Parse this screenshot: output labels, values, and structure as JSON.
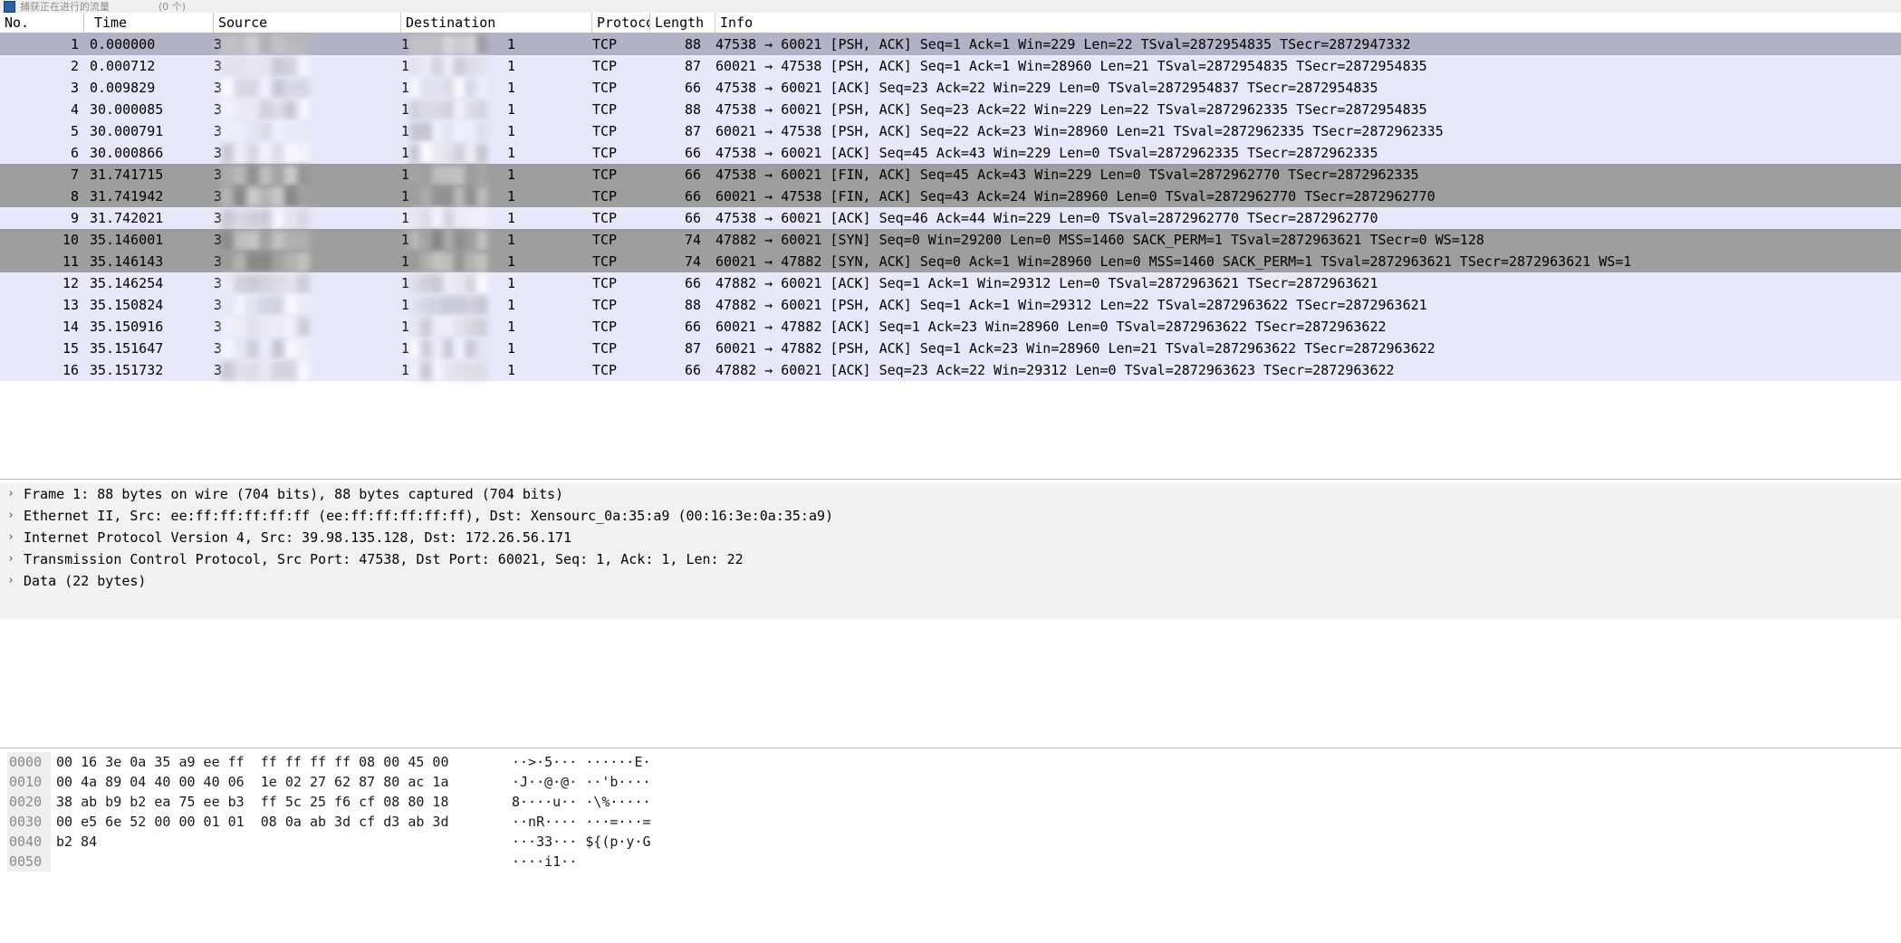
{
  "window": {
    "title_text": "捕获正在进行的流量",
    "title_suffix": "(0 个)"
  },
  "packet_list": {
    "columns": [
      {
        "key": "no",
        "label": "No."
      },
      {
        "key": "time",
        "label": "Time"
      },
      {
        "key": "src",
        "label": "Source"
      },
      {
        "key": "dst",
        "label": "Destination"
      },
      {
        "key": "prot",
        "label": "Protocol"
      },
      {
        "key": "len",
        "label": "Length"
      },
      {
        "key": "info",
        "label": "Info"
      }
    ],
    "redacted_src_prefix": "3",
    "redacted_src_suffix": "",
    "redacted_dst_prefix": "1",
    "redacted_dst_suffix": "1",
    "rows": [
      {
        "no": "1",
        "time": "0.000000",
        "prot": "TCP",
        "len": "88",
        "info": "47538 → 60021 [PSH, ACK] Seq=1 Ack=1 Win=229 Len=22 TSval=2872954835 TSecr=2872947332",
        "state": "selected"
      },
      {
        "no": "2",
        "time": "0.000712",
        "prot": "TCP",
        "len": "87",
        "info": "60021 → 47538 [PSH, ACK] Seq=1 Ack=1 Win=28960 Len=21 TSval=2872954835 TSecr=2872954835",
        "state": "normal"
      },
      {
        "no": "3",
        "time": "0.009829",
        "prot": "TCP",
        "len": "66",
        "info": "47538 → 60021 [ACK] Seq=23 Ack=22 Win=229 Len=0 TSval=2872954837 TSecr=2872954835",
        "state": "normal"
      },
      {
        "no": "4",
        "time": "30.000085",
        "prot": "TCP",
        "len": "88",
        "info": "47538 → 60021 [PSH, ACK] Seq=23 Ack=22 Win=229 Len=22 TSval=2872962335 TSecr=2872954835",
        "state": "normal"
      },
      {
        "no": "5",
        "time": "30.000791",
        "prot": "TCP",
        "len": "87",
        "info": "60021 → 47538 [PSH, ACK] Seq=22 Ack=23 Win=28960 Len=21 TSval=2872962335 TSecr=2872962335",
        "state": "normal"
      },
      {
        "no": "6",
        "time": "30.000866",
        "prot": "TCP",
        "len": "66",
        "info": "47538 → 60021 [ACK] Seq=45 Ack=43 Win=229 Len=0 TSval=2872962335 TSecr=2872962335",
        "state": "normal"
      },
      {
        "no": "7",
        "time": "31.741715",
        "prot": "TCP",
        "len": "66",
        "info": "47538 → 60021 [FIN, ACK] Seq=45 Ack=43 Win=229 Len=0 TSval=2872962770 TSecr=2872962335",
        "state": "marked"
      },
      {
        "no": "8",
        "time": "31.741942",
        "prot": "TCP",
        "len": "66",
        "info": "60021 → 47538 [FIN, ACK] Seq=43 Ack=24 Win=28960 Len=0 TSval=2872962770 TSecr=2872962770",
        "state": "marked"
      },
      {
        "no": "9",
        "time": "31.742021",
        "prot": "TCP",
        "len": "66",
        "info": "47538 → 60021 [ACK] Seq=46 Ack=44 Win=229 Len=0 TSval=2872962770 TSecr=2872962770",
        "state": "normal"
      },
      {
        "no": "10",
        "time": "35.146001",
        "prot": "TCP",
        "len": "74",
        "info": "47882 → 60021 [SYN] Seq=0 Win=29200 Len=0 MSS=1460 SACK_PERM=1 TSval=2872963621 TSecr=0 WS=128",
        "state": "marked"
      },
      {
        "no": "11",
        "time": "35.146143",
        "prot": "TCP",
        "len": "74",
        "info": "60021 → 47882 [SYN, ACK] Seq=0 Ack=1 Win=28960 Len=0 MSS=1460 SACK_PERM=1 TSval=2872963621 TSecr=2872963621 WS=1",
        "state": "marked"
      },
      {
        "no": "12",
        "time": "35.146254",
        "prot": "TCP",
        "len": "66",
        "info": "47882 → 60021 [ACK] Seq=1 Ack=1 Win=29312 Len=0 TSval=2872963621 TSecr=2872963621",
        "state": "normal"
      },
      {
        "no": "13",
        "time": "35.150824",
        "prot": "TCP",
        "len": "88",
        "info": "47882 → 60021 [PSH, ACK] Seq=1 Ack=1 Win=29312 Len=22 TSval=2872963622 TSecr=2872963621",
        "state": "normal"
      },
      {
        "no": "14",
        "time": "35.150916",
        "prot": "TCP",
        "len": "66",
        "info": "60021 → 47882 [ACK] Seq=1 Ack=23 Win=28960 Len=0 TSval=2872963622 TSecr=2872963622",
        "state": "normal"
      },
      {
        "no": "15",
        "time": "35.151647",
        "prot": "TCP",
        "len": "87",
        "info": "60021 → 47882 [PSH, ACK] Seq=1 Ack=23 Win=28960 Len=21 TSval=2872963622 TSecr=2872963622",
        "state": "normal"
      },
      {
        "no": "16",
        "time": "35.151732",
        "prot": "TCP",
        "len": "66",
        "info": "47882 → 60021 [ACK] Seq=23 Ack=22 Win=29312 Len=0 TSval=2872963623 TSecr=2872963622",
        "state": "normal"
      }
    ]
  },
  "packet_detail": {
    "expander_glyph": "›",
    "rows": [
      {
        "text": "Frame 1: 88 bytes on wire (704 bits), 88 bytes captured (704 bits)"
      },
      {
        "text": "Ethernet II, Src: ee:ff:ff:ff:ff:ff (ee:ff:ff:ff:ff:ff), Dst: Xensourc_0a:35:a9 (00:16:3e:0a:35:a9)"
      },
      {
        "text": "Internet Protocol Version 4, Src: 39.98.135.128, Dst: 172.26.56.171"
      },
      {
        "text": "Transmission Control Protocol, Src Port: 47538, Dst Port: 60021, Seq: 1, Ack: 1, Len: 22"
      },
      {
        "text": "Data (22 bytes)"
      }
    ]
  },
  "hex_dump": {
    "rows": [
      {
        "offset": "0000",
        "bytes": "00 16 3e 0a 35 a9 ee ff  ff ff ff ff 08 00 45 00",
        "ascii": "··>·5··· ······E·",
        "redacted": false
      },
      {
        "offset": "0010",
        "bytes": "00 4a 89 04 40 00 40 06  1e 02 27 62 87 80 ac 1a",
        "ascii": "·J··@·@· ··'b····",
        "redacted": false
      },
      {
        "offset": "0020",
        "bytes": "38 ab b9 b2 ea 75 ee b3  ff 5c 25 f6 cf 08 80 18",
        "ascii": "8····u·· ·\\%·····",
        "redacted": false
      },
      {
        "offset": "0030",
        "bytes": "00 e5 6e 52 00 00 01 01  08 0a ab 3d cf d3 ab 3d",
        "ascii": "··nR···· ···=···=",
        "redacted": false
      },
      {
        "offset": "0040",
        "bytes": "b2 84",
        "ascii": "···33··· ${(p·y·G",
        "redacted": true
      },
      {
        "offset": "0050",
        "bytes": "",
        "ascii": "····i1··",
        "redacted": true
      }
    ]
  },
  "colors": {
    "row_normal": "#e7e8fa",
    "row_selected": "#b2b2c6",
    "row_marked": "#9e9e9e",
    "detail_bg": "#f2f2f2",
    "hex_offset": "#8a8a8a"
  }
}
